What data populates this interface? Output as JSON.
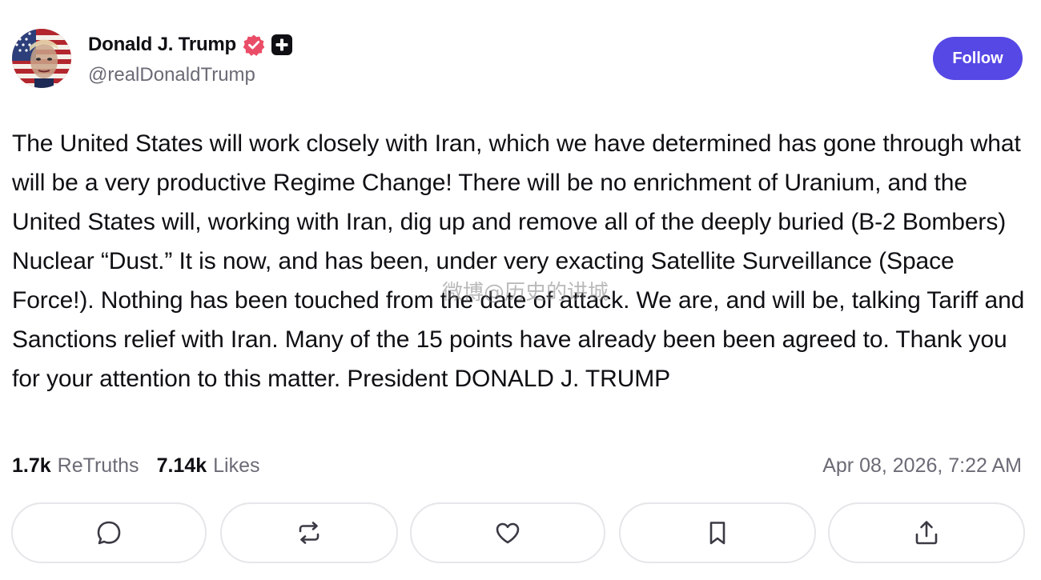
{
  "author": {
    "display_name": "Donald J. Trump",
    "handle": "@realDonaldTrump",
    "avatar_icon": "flag-portrait-avatar",
    "verified_icon": "verified-badge-icon",
    "plus_icon": "plus-badge-icon"
  },
  "follow_button": {
    "label": "Follow",
    "color": "#5648e5"
  },
  "post": {
    "text": "The United States will work closely with Iran, which we have determined has gone through what will be a very productive Regime Change! There will be no enrichment of Uranium, and the United States will, working with Iran, dig up and remove all of the deeply buried (B-2 Bombers) Nuclear “Dust.” It is now, and has been, under very exacting Satellite Surveillance (Space Force!). Nothing has been touched from the date of attack. We are, and will be, talking Tariff and Sanctions relief with Iran. Many of the 15 points have already been been agreed to. Thank you for your attention to this matter. President DONALD J. TRUMP"
  },
  "watermark": {
    "text": "微博@历史的讲城"
  },
  "stats": {
    "retruths_count": "1.7k",
    "retruths_label": "ReTruths",
    "likes_count": "7.14k",
    "likes_label": "Likes",
    "timestamp": "Apr 08, 2026, 7:22 AM"
  },
  "actions": [
    {
      "name": "reply",
      "icon": "comment-icon"
    },
    {
      "name": "retruth",
      "icon": "repost-icon"
    },
    {
      "name": "like",
      "icon": "heart-icon"
    },
    {
      "name": "bookmark",
      "icon": "bookmark-icon"
    },
    {
      "name": "share",
      "icon": "share-icon"
    }
  ],
  "colors": {
    "accent": "#5648e5",
    "verified": "#ea4d67",
    "text": "#0f0f14",
    "muted": "#6b6b76",
    "border": "#e6e6ea"
  }
}
